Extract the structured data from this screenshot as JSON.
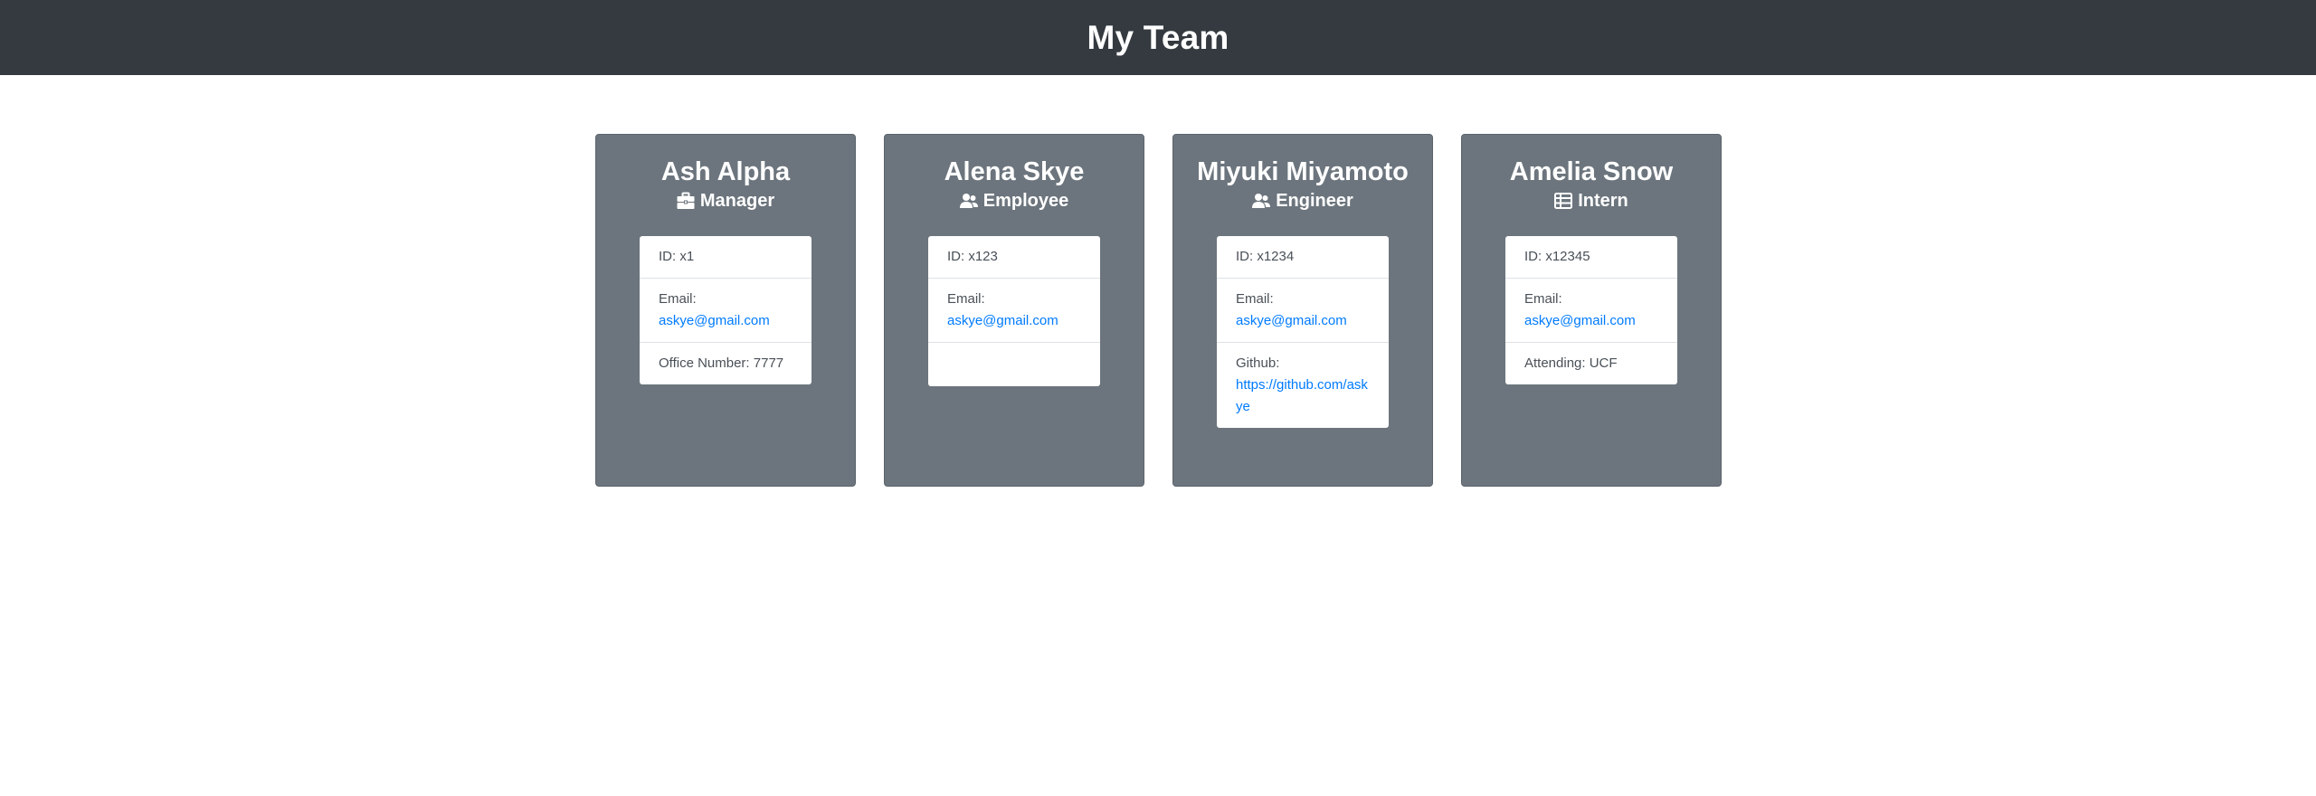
{
  "header": {
    "title": "My Team"
  },
  "team": [
    {
      "name": "Ash Alpha",
      "role": "Manager",
      "icon": "briefcase-icon",
      "id_text": "ID: x1",
      "email_label": "Email:",
      "email": "askye@gmail.com",
      "extra_label": "Office Number: 7777",
      "extra_link": ""
    },
    {
      "name": "Alena Skye",
      "role": "Employee",
      "icon": "users-icon",
      "id_text": "ID: x123",
      "email_label": "Email:",
      "email": "askye@gmail.com",
      "extra_label": "",
      "extra_link": ""
    },
    {
      "name": "Miyuki Miyamoto",
      "role": "Engineer",
      "icon": "users-icon",
      "id_text": "ID: x1234",
      "email_label": "Email:",
      "email": "askye@gmail.com",
      "extra_label": "Github:",
      "extra_link": "https://github.com/askye"
    },
    {
      "name": "Amelia Snow",
      "role": "Intern",
      "icon": "table-list-icon",
      "id_text": "ID: x12345",
      "email_label": "Email:",
      "email": "askye@gmail.com",
      "extra_label": "Attending: UCF",
      "extra_link": ""
    }
  ]
}
